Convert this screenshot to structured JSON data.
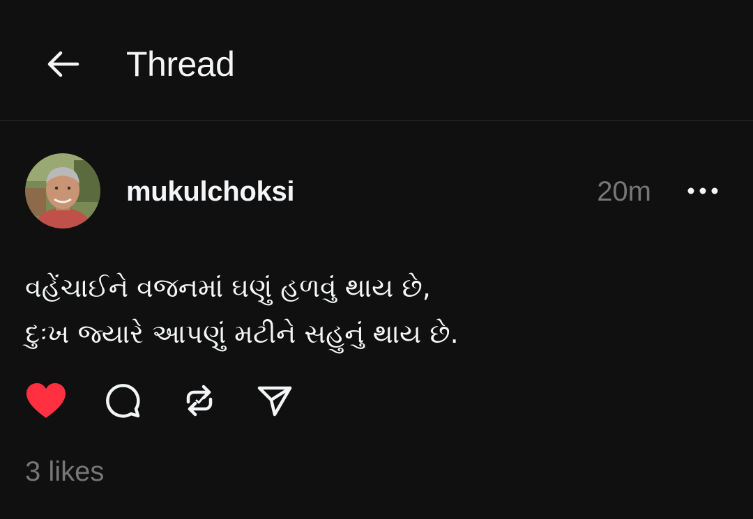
{
  "header": {
    "back_icon": "arrow-left-icon",
    "title": "Thread"
  },
  "post": {
    "author": {
      "username": "mukulchoksi",
      "avatar_icon": "profile-photo"
    },
    "time": "20m",
    "more_icon": "more-horizontal-icon",
    "text": "વહેંચાઈને  વજનમાં ઘણું હળવું થાય છે,\nદુઃખ જ્યારે આપણું મટીને સહુનું થાય છે.",
    "actions": {
      "like_icon": "heart-filled-icon",
      "comment_icon": "comment-icon",
      "repost_icon": "repost-icon",
      "share_icon": "send-icon",
      "liked": true
    },
    "likes_text": "3 likes"
  },
  "colors": {
    "background": "#101010",
    "text": "#f3f5f7",
    "muted": "#777777",
    "like": "#ff3040",
    "divider": "#2d2d2d"
  }
}
